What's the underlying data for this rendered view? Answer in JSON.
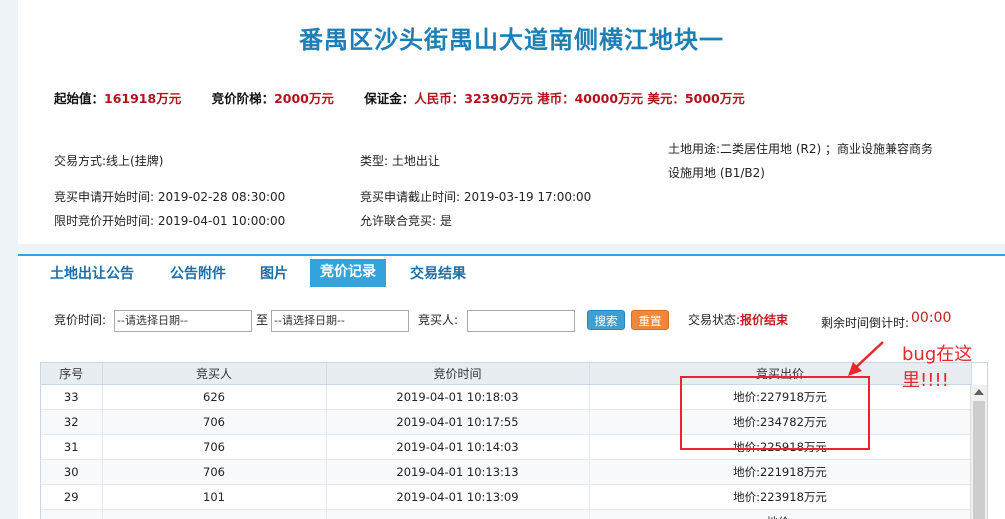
{
  "title": "番禺区沙头街禺山大道南侧横江地块一",
  "prices": {
    "start_label": "起始值：",
    "start_value": "161918万元",
    "step_label": "竞价阶梯：",
    "step_value": "2000万元",
    "deposit_label": "保证金：",
    "deposit_value": "人民币：32390万元 港币：40000万元 美元：5000万元"
  },
  "info": {
    "trade_mode": "交易方式:线上(挂牌)",
    "type": "类型: 土地出让",
    "land_use_line1": "土地用途:二类居住用地 (R2) ；商业设施兼容商务",
    "land_use_line2": "设施用地 (B1/B2)",
    "apply_start": "竞买申请开始时间:  2019-02-28 08:30:00",
    "apply_end": "竞买申请截止时间: 2019-03-19 17:00:00",
    "limit_start": "限时竞价开始时间: 2019-04-01 10:00:00",
    "joint_bid": "允许联合竞买: 是"
  },
  "tabs": [
    {
      "label": "土地出让公告"
    },
    {
      "label": "公告附件"
    },
    {
      "label": "图片"
    },
    {
      "label": "竞价记录"
    },
    {
      "label": "交易结果"
    }
  ],
  "filter": {
    "time_label": "竞价时间:",
    "date_from_placeholder": "--请选择日期--",
    "to_label": "至",
    "date_to_placeholder": "--请选择日期--",
    "bidder_label": "竞买人:",
    "search_label": "搜索",
    "reset_label": "重置",
    "status_label": "交易状态:",
    "status_value": "报价结束",
    "countdown_label": "剩余时间倒计时:",
    "countdown_value": "00:00"
  },
  "table": {
    "headers": [
      "序号",
      "竞买人",
      "竞价时间",
      "竞买出价"
    ],
    "rows": [
      [
        "33",
        "626",
        "2019-04-01 10:18:03",
        "地价:227918万元"
      ],
      [
        "32",
        "706",
        "2019-04-01 10:17:55",
        "地价:234782万元"
      ],
      [
        "31",
        "706",
        "2019-04-01 10:14:03",
        "地价:225918万元"
      ],
      [
        "30",
        "706",
        "2019-04-01 10:13:13",
        "地价:221918万元"
      ],
      [
        "29",
        "101",
        "2019-04-01 10:13:09",
        "地价:223918万元"
      ],
      [
        "",
        "",
        "",
        "地价:"
      ]
    ]
  },
  "annotation": {
    "line1": "bug在这",
    "line2": "里!!!!",
    "color": "#e8262b"
  }
}
